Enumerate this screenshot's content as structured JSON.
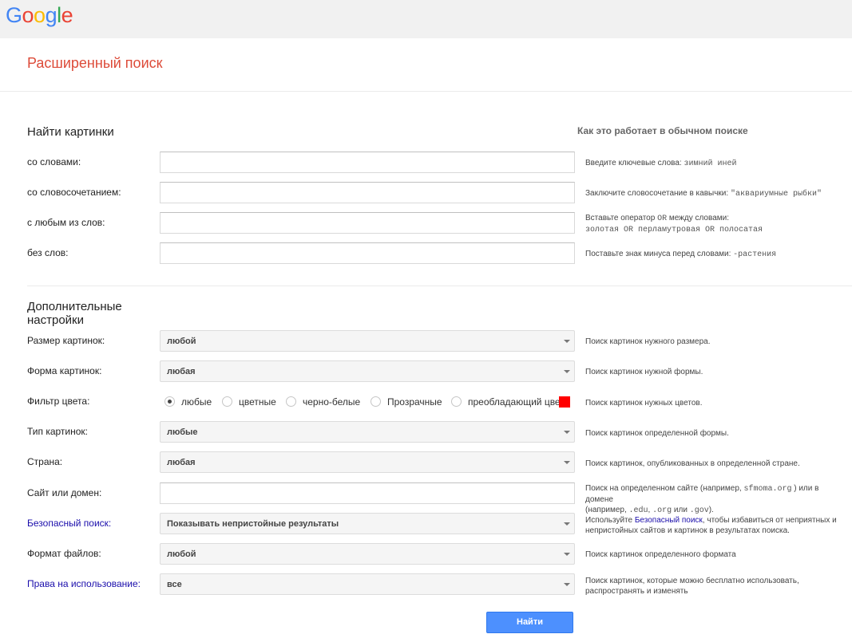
{
  "logo": {
    "letters": [
      {
        "ch": "G",
        "color": "#4285f4"
      },
      {
        "ch": "o",
        "color": "#ea4335"
      },
      {
        "ch": "o",
        "color": "#fbbc05"
      },
      {
        "ch": "g",
        "color": "#4285f4"
      },
      {
        "ch": "l",
        "color": "#34a853"
      },
      {
        "ch": "e",
        "color": "#ea4335"
      }
    ]
  },
  "page_title": "Расширенный поиск",
  "section1": {
    "title": "Найти картинки",
    "how_title": "Как это работает в обычном поиске",
    "rows": [
      {
        "label": "со словами:",
        "value": "",
        "hint": "Введите ключевые слова: ",
        "hint_code": "зимний иней"
      },
      {
        "label": "со словосочетанием:",
        "value": "",
        "hint": "Заключите словосочетание в кавычки: ",
        "hint_code": "\"аквариумные рыбки\""
      },
      {
        "label": "с любым из слов:",
        "value": "",
        "hint_a": "Вставьте оператор ",
        "hint_or": "OR",
        "hint_b": " между словами:",
        "hint_line2": "золотая OR перламутровая OR полосатая"
      },
      {
        "label": "без слов:",
        "value": "",
        "hint": "Поставьте знак минуса перед словами: ",
        "hint_code": "-растения"
      }
    ]
  },
  "section2": {
    "title_line1": "Дополнительные",
    "title_line2": "настройки",
    "size": {
      "label": "Размер картинок:",
      "value": "любой",
      "hint": "Поиск картинок нужного размера."
    },
    "shape": {
      "label": "Форма картинок:",
      "value": "любая",
      "hint": "Поиск картинок нужной формы."
    },
    "color": {
      "label": "Фильтр цвета:",
      "options": [
        "любые",
        "цветные",
        "черно-белые",
        "Прозрачные",
        "преобладающий цвет"
      ],
      "selected": "любые",
      "swatch_color": "#ff0000",
      "hint": "Поиск картинок нужных цветов."
    },
    "type": {
      "label": "Тип картинок:",
      "value": "любые",
      "hint": "Поиск картинок определенной формы."
    },
    "country": {
      "label": "Страна:",
      "value": "любая",
      "hint": "Поиск картинок, опубликованных в определенной стране."
    },
    "site": {
      "label": "Сайт или домен:",
      "value": "",
      "hint_a": "Поиск на определенном сайте (например, ",
      "hint_code1": "sfmoma.org",
      "hint_b": ") или в домене",
      "hint_c": "(например, ",
      "hint_code2": ".edu",
      "hint_d": ", ",
      "hint_code3": ".org",
      "hint_e": " или ",
      "hint_code4": ".gov",
      "hint_f": ")."
    },
    "safe": {
      "label": "Безопасный поиск:",
      "value": "Показывать непристойные результаты",
      "hint_a": "Используйте ",
      "hint_link": "Безопасный поиск",
      "hint_b": ", чтобы избавиться от неприятных и",
      "hint_line2": "непристойных сайтов и картинок в результатах поиска."
    },
    "format": {
      "label": "Формат файлов:",
      "value": "любой",
      "hint": "Поиск картинок определенного формата"
    },
    "rights": {
      "label": "Права на использование:",
      "value": "все",
      "hint_line1": "Поиск картинок, которые можно бесплатно использовать,",
      "hint_line2": "распространять и изменять"
    }
  },
  "search_button": "Найти"
}
